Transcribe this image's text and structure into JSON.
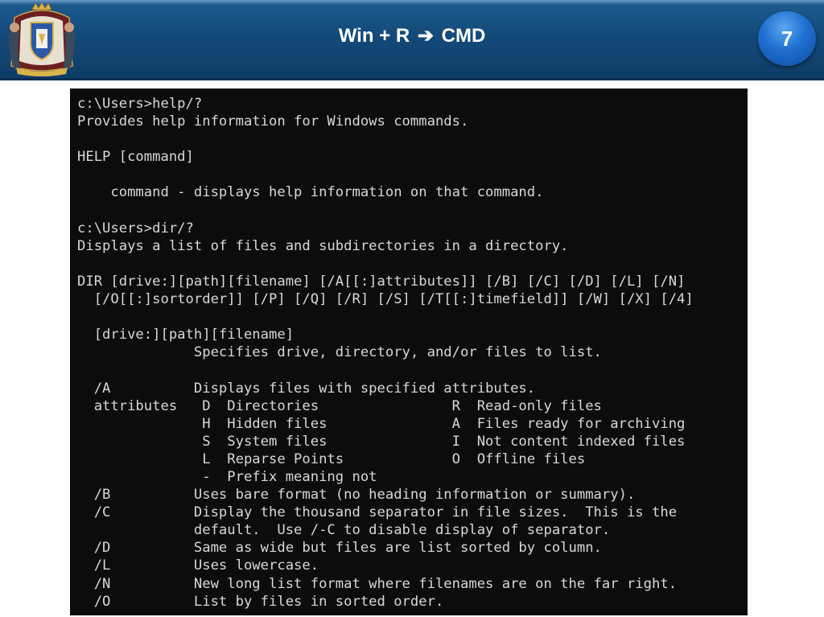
{
  "header": {
    "title_left": "Win + R",
    "title_arrow": "➔",
    "title_right": "CMD",
    "page_number": "7",
    "logo_icon": "coat-of-arms-icon",
    "bar_color": "#134a7a",
    "badge_color": "#1f6fd0"
  },
  "terminal": {
    "background": "#0c0c0c",
    "text_color": "#d8d8d8",
    "lines": [
      "c:\\Users>help/?",
      "Provides help information for Windows commands.",
      "",
      "HELP [command]",
      "",
      "    command - displays help information on that command.",
      "",
      "c:\\Users>dir/?",
      "Displays a list of files and subdirectories in a directory.",
      "",
      "DIR [drive:][path][filename] [/A[[:]attributes]] [/B] [/C] [/D] [/L] [/N]",
      "  [/O[[:]sortorder]] [/P] [/Q] [/R] [/S] [/T[[:]timefield]] [/W] [/X] [/4]",
      "",
      "  [drive:][path][filename]",
      "              Specifies drive, directory, and/or files to list.",
      "",
      "  /A          Displays files with specified attributes.",
      "  attributes   D  Directories                R  Read-only files",
      "               H  Hidden files               A  Files ready for archiving",
      "               S  System files               I  Not content indexed files",
      "               L  Reparse Points             O  Offline files",
      "               -  Prefix meaning not",
      "  /B          Uses bare format (no heading information or summary).",
      "  /C          Display the thousand separator in file sizes.  This is the",
      "              default.  Use /-C to disable display of separator.",
      "  /D          Same as wide but files are list sorted by column.",
      "  /L          Uses lowercase.",
      "  /N          New long list format where filenames are on the far right.",
      "  /O          List by files in sorted order."
    ]
  }
}
